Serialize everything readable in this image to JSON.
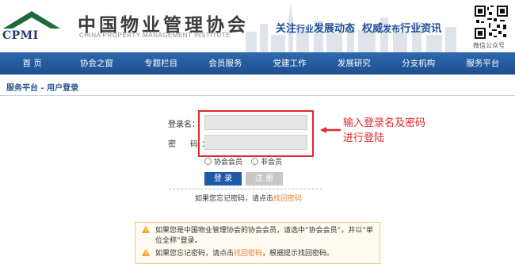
{
  "header": {
    "logo_text": "CPMI",
    "org_name_cn": "中国物业管理协会",
    "org_name_en": "CHINA PROPERTY MANAGEMENT INSTITUTE",
    "slogan_a_big": "关注",
    "slogan_a_small": "行业",
    "slogan_a_rest": "发展动态",
    "slogan_b_big": "权威",
    "slogan_b_small": "发布",
    "slogan_b_rest": "行业资讯",
    "qr_label": "微信公众号"
  },
  "nav": {
    "items": [
      "首 页",
      "协会之窗",
      "专题栏目",
      "会员服务",
      "党建工作",
      "发展研究",
      "分支机构",
      "服务平台"
    ]
  },
  "page": {
    "breadcrumb_title": "服务平台 - 用户登录"
  },
  "login_form": {
    "username_label": "登录名：",
    "password_label": "密　码：",
    "username_value": "",
    "password_value": "",
    "radio_member": "协会会员",
    "radio_non_member": "非会员",
    "login_button": "登 录",
    "register_button": "注 册",
    "forgot_prefix": "如果您忘记密码，请点击",
    "forgot_link": "找回密码"
  },
  "annotation": {
    "line1": "输入登录名及密码",
    "line2": "进行登陆",
    "color": "#e0282e"
  },
  "notice": {
    "item1_line1": "如果您是中国物业管理协会的协会会员，请选中“协会会员”，并以“单",
    "item1_line2": "位全称”登录。",
    "item2_prefix": "如果您忘记密码，请点击",
    "item2_link": "找回密码",
    "item2_suffix": "，根据提示找回密码。"
  },
  "colors": {
    "nav_bg": "#1c4f92",
    "accent": "#1f5aa6",
    "link": "#e6812f",
    "notice_border": "#f0c98e"
  }
}
